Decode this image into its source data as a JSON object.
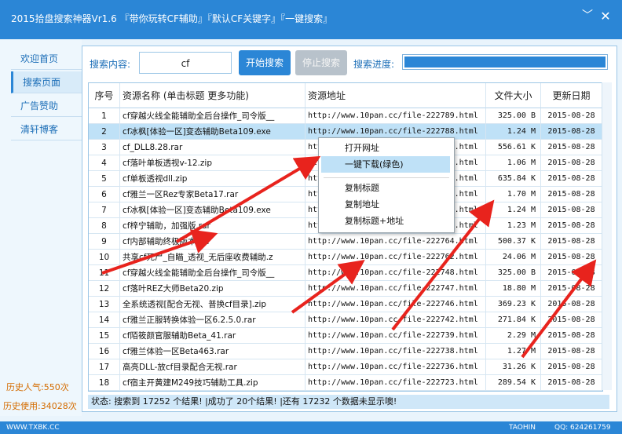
{
  "window": {
    "title": "2015拾盘搜索神器Vr1.6  『带你玩转CF辅助』『默认CF关键字』『一键搜索』",
    "min_glyph": "﹀",
    "close_glyph": "✕"
  },
  "sidebar": {
    "items": [
      {
        "label": "欢迎首页"
      },
      {
        "label": "搜索页面"
      },
      {
        "label": "广告赞助"
      },
      {
        "label": "清轩博客"
      }
    ],
    "active_index": 1,
    "stats": {
      "popularity": "历史人气:550次",
      "usage": "历史使用:34028次"
    }
  },
  "search": {
    "content_label": "搜索内容:",
    "keyword": "cf",
    "start_button": "开始搜索",
    "stop_button": "停止搜索",
    "progress_label": "搜索进度:",
    "progress_fraction": 1.0
  },
  "table": {
    "columns": [
      "序号",
      "资源名称 (单击标题 更多功能)",
      "资源地址",
      "文件大小",
      "更新日期"
    ],
    "rows": [
      {
        "no": "1",
        "name": "cf穿越火线全能辅助全后台操作_司令版__",
        "url": "http://www.10pan.cc/file-222789.html",
        "size": "325.00 B",
        "date": "2015-08-28"
      },
      {
        "no": "2",
        "name": "cf冰枫[体验一区]变态辅助Beta109.exe",
        "url": "http://www.10pan.cc/file-222788.html",
        "size": "1.24 M",
        "date": "2015-08-28"
      },
      {
        "no": "3",
        "name": "cf_DLL8.28.rar",
        "url": "http://www.10pan.cc/file-222787.html",
        "size": "556.61 K",
        "date": "2015-08-28"
      },
      {
        "no": "4",
        "name": "cf落叶单板透视v-12.zip",
        "url": "http://www.10pan.cc/file-222786.html",
        "size": "1.06 M",
        "date": "2015-08-28"
      },
      {
        "no": "5",
        "name": "cf单板透视dll.zip",
        "url": "http://www.10pan.cc/file-222785.html",
        "size": "635.84 K",
        "date": "2015-08-28"
      },
      {
        "no": "6",
        "name": "cf雅兰一区Rez专家Beta17.rar",
        "url": "http://www.10pan.cc/file-222784.html",
        "size": "1.70 M",
        "date": "2015-08-28"
      },
      {
        "no": "7",
        "name": "cf冰枫[体验一区]变态辅助Beta109.exe",
        "url": "http://www.10pan.cc/file-222783.html",
        "size": "1.24 M",
        "date": "2015-08-28"
      },
      {
        "no": "8",
        "name": "cf梓宁辅助，加强版.rar",
        "url": "http://www.10pan.cc/file-222782.html",
        "size": "1.23 M",
        "date": "2015-08-28"
      },
      {
        "no": "9",
        "name": "cf内部辅助终极版本.rar",
        "url": "http://www.10pan.cc/file-222764.html",
        "size": "500.37 K",
        "date": "2015-08-28"
      },
      {
        "no": "10",
        "name": "共享cf死尸_自瞄_透视_无后座收费辅助.z",
        "url": "http://www.10pan.cc/file-222762.html",
        "size": "24.06 M",
        "date": "2015-08-28"
      },
      {
        "no": "11",
        "name": "cf穿越火线全能辅助全后台操作_司令版__",
        "url": "http://www.10pan.cc/file-222748.html",
        "size": "325.00 B",
        "date": "2015-08-28"
      },
      {
        "no": "12",
        "name": "cf落叶REZ大师Beta20.zip",
        "url": "http://www.10pan.cc/file-222747.html",
        "size": "18.80 M",
        "date": "2015-08-28"
      },
      {
        "no": "13",
        "name": "全系统透视[配合无视、普换cf目录].zip",
        "url": "http://www.10pan.cc/file-222746.html",
        "size": "369.23 K",
        "date": "2015-08-28"
      },
      {
        "no": "14",
        "name": "cf雅兰正服转换体验一区6.2.5.0.rar",
        "url": "http://www.10pan.cc/file-222742.html",
        "size": "271.84 K",
        "date": "2015-08-28"
      },
      {
        "no": "15",
        "name": "cf陌筱颜官服辅助Beta_41.rar",
        "url": "http://www.10pan.cc/file-222739.html",
        "size": "2.29 M",
        "date": "2015-08-28"
      },
      {
        "no": "16",
        "name": "cf雅兰体验一区Beta463.rar",
        "url": "http://www.10pan.cc/file-222738.html",
        "size": "1.27 M",
        "date": "2015-08-28"
      },
      {
        "no": "17",
        "name": "高亮DLL-放cf目录配合无视.rar",
        "url": "http://www.10pan.cc/file-222736.html",
        "size": "31.26 K",
        "date": "2015-08-28"
      },
      {
        "no": "18",
        "name": "cf宿主开黄建M249技巧辅助工具.zip",
        "url": "http://www.10pan.cc/file-222723.html",
        "size": "289.54 K",
        "date": "2015-08-28"
      }
    ],
    "selected_row": 2
  },
  "context_menu": {
    "items": [
      "打开网址",
      "一键下载(绿色)",
      "复制标题",
      "复制地址",
      "复制标题+地址"
    ],
    "highlighted": "一键下载(绿色)"
  },
  "status_bar": {
    "text": "状态: 搜索到  17252  个结果!  |成功了  20个结果!  |还有 17232 个数据未显示噢!"
  },
  "footer": {
    "left": "WWW.TXBK.CC",
    "author": "TAOHIN",
    "qq": "QQ: 624261759"
  },
  "colors": {
    "title_bar": "#2b86d6",
    "accent": "#2b86d6",
    "annotation_arrows": "#e8231d",
    "selected_row": "#bfe1f7"
  }
}
